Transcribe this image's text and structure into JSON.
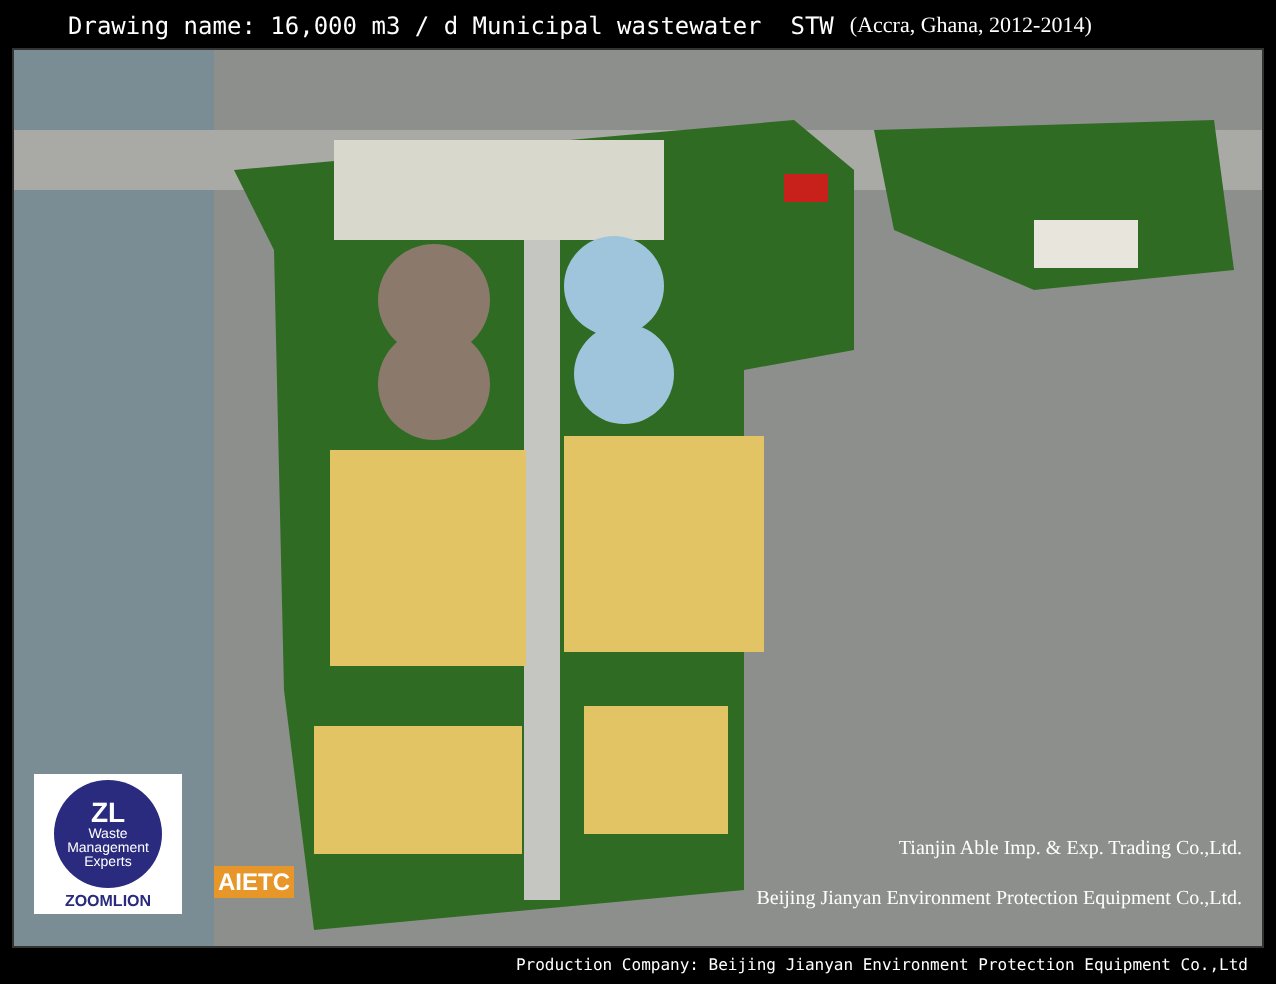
{
  "title": {
    "main": "Drawing name: 16,000 m3 / d Municipal wastewater  STW",
    "note": "(Accra, Ghana, 2012-2014)"
  },
  "logos": {
    "zoomlion_mark": "ZL",
    "zoomlion_tagline": "Waste Management Experts",
    "zoomlion_name": "ZOOMLION",
    "aietc": "AIETC"
  },
  "companies": [
    "Tianjin Able Imp. & Exp. Trading Co.,Ltd.",
    "Beijing Jianyan Environment Protection Equipment Co.,Ltd."
  ],
  "footer": "Production Company: Beijing Jianyan Environment Protection Equipment Co.,Ltd"
}
